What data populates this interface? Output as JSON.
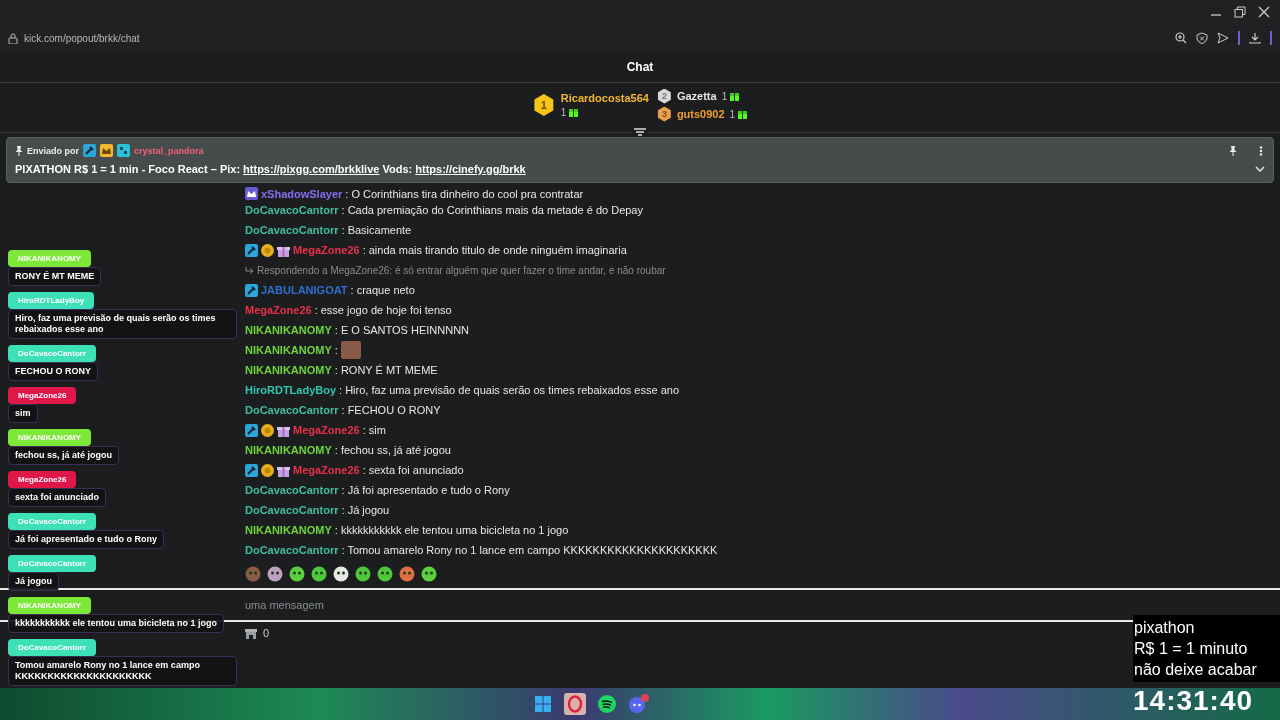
{
  "browser": {
    "url": "kick.com/popout/brkk/chat"
  },
  "chat": {
    "title": "Chat"
  },
  "top_gifters": [
    {
      "rank": "1",
      "name": "Ricardocosta564",
      "count": "1",
      "color": "#f5b731"
    },
    {
      "rank": "2",
      "name": "Gazetta",
      "count": "1",
      "color": "#e8e8e8"
    },
    {
      "rank": "3",
      "name": "guts0902",
      "count": "1",
      "color": "#f0a030"
    }
  ],
  "pinned": {
    "label": "Enviado por",
    "author": "crystal_pandora",
    "message": [
      {
        "kind": "text",
        "text": "PIXATHON R$ 1 = 1 min - Foco React – Pix: "
      },
      {
        "kind": "link",
        "text": "https://pixgg.com/brkklive"
      },
      {
        "kind": "text",
        "text": " Vods: "
      },
      {
        "kind": "link",
        "text": "https://cinefy.gg/brkk"
      }
    ]
  },
  "messages": [
    {
      "kind": "message",
      "badges": [
        {
          "kind": "sub"
        }
      ],
      "username": "xShadowSlayer",
      "color": "#8a6cf0",
      "text": ": O Corinthians tira dinheiro do cool pra contratar"
    },
    {
      "kind": "message",
      "username": "DoCavacoCantorr",
      "color": "#3fbfa0",
      "text": ": Cada premiação do Corinthians mais da metade é do Depay"
    },
    {
      "kind": "message",
      "username": "DoCavacoCantorr",
      "color": "#3fbfa0",
      "text": ": Basicamente"
    },
    {
      "kind": "message",
      "badges": [
        {
          "kind": "mod"
        },
        {
          "kind": "vip"
        },
        {
          "kind": "gift"
        }
      ],
      "username": "MegaZone26",
      "color": "#e8304a",
      "text": ": ainda mais tirando titulo de onde ninguém imaginaria"
    },
    {
      "kind": "reply",
      "text": "Respondendo a MegaZone26: é só entrar alguém que quer fazer o time andar, e não roubar"
    },
    {
      "kind": "message",
      "badges": [
        {
          "kind": "mod"
        }
      ],
      "username": "JABULANIGOAT",
      "color": "#2f6fd0",
      "text": ": craque neto"
    },
    {
      "kind": "message",
      "username": "MegaZone26",
      "color": "#e8304a",
      "text": ": esse jogo de hoje foi tenso"
    },
    {
      "kind": "message",
      "username": "NIKANIKANOMY",
      "color": "#6fd63a",
      "text": ": E O SANTOS HEINNNNN"
    },
    {
      "kind": "emote",
      "username": "NIKANIKANOMY",
      "color": "#6fd63a",
      "text": ":"
    },
    {
      "kind": "message",
      "username": "NIKANIKANOMY",
      "color": "#6fd63a",
      "text": ": RONY É MT MEME"
    },
    {
      "kind": "message",
      "username": "HiroRDTLadyBoy",
      "color": "#2fc8b0",
      "text": ": Hiro, faz uma previsão de quais serão os times rebaixados esse ano"
    },
    {
      "kind": "message",
      "username": "DoCavacoCantorr",
      "color": "#3fbfa0",
      "text": ": FECHOU O RONY"
    },
    {
      "kind": "message",
      "badges": [
        {
          "kind": "mod"
        },
        {
          "kind": "vip"
        },
        {
          "kind": "gift"
        }
      ],
      "username": "MegaZone26",
      "color": "#e8304a",
      "text": ": sim"
    },
    {
      "kind": "message",
      "username": "NIKANIKANOMY",
      "color": "#6fd63a",
      "text": ": fechou ss, já até jogou"
    },
    {
      "kind": "message",
      "badges": [
        {
          "kind": "mod"
        },
        {
          "kind": "vip"
        },
        {
          "kind": "gift"
        }
      ],
      "username": "MegaZone26",
      "color": "#e8304a",
      "text": ": sexta foi anunciado"
    },
    {
      "kind": "message",
      "username": "DoCavacoCantorr",
      "color": "#3fbfa0",
      "text": ": Já foi apresentado e tudo o Rony"
    },
    {
      "kind": "message",
      "username": "DoCavacoCantorr",
      "color": "#3fbfa0",
      "text": ": Já jogou"
    },
    {
      "kind": "message",
      "username": "NIKANIKANOMY",
      "color": "#6fd63a",
      "text": ": kkkkkkkkkkk ele tentou uma bicicleta no 1 jogo"
    },
    {
      "kind": "message",
      "username": "DoCavacoCantorr",
      "color": "#3fbfa0",
      "text": ": Tomou amarelo Rony no 1 lance em campo KKKKKKKKKKKKKKKKKKKKK"
    }
  ],
  "input": {
    "placeholder": "uma mensagem"
  },
  "footer": {
    "count": "0"
  },
  "alerts": [
    {
      "username": "NIKANIKANOMY",
      "color": "#7de83a",
      "text": "RONY É MT MEME"
    },
    {
      "username": "HiroRDTLadyBoy",
      "color": "#3ee0b8",
      "text": "Hiro, faz uma previsão de quais serão os times rebaixados esse ano"
    },
    {
      "username": "DoCavacoCantorr",
      "color": "#3ee0b8",
      "text": "FECHOU O RONY"
    },
    {
      "username": "MegaZone26",
      "color": "#e0184a",
      "text": "sim"
    },
    {
      "username": "NIKANIKANOMY",
      "color": "#7de83a",
      "text": "fechou ss, já até jogou"
    },
    {
      "username": "MegaZone26",
      "color": "#e0184a",
      "text": "sexta foi anunciado"
    },
    {
      "username": "DoCavacoCantorr",
      "color": "#3ee0b8",
      "text": "Já foi apresentado e tudo o Rony"
    },
    {
      "username": "DoCavacoCantorr",
      "color": "#3ee0b8",
      "text": "Já jogou"
    },
    {
      "username": "NIKANIKANOMY",
      "color": "#7de83a",
      "text": "kkkkkkkkkkk ele tentou uma bicicleta no 1 jogo"
    },
    {
      "username": "DoCavacoCantorr",
      "color": "#3ee0b8",
      "text": "Tomou amarelo Rony no 1 lance em campo KKKKKKKKKKKKKKKKKKKKK"
    }
  ],
  "stream_info": {
    "lines": [
      "pixathon",
      "R$ 1 = 1 minuto",
      "não deixe acabar"
    ],
    "clock": "14:31:40"
  }
}
